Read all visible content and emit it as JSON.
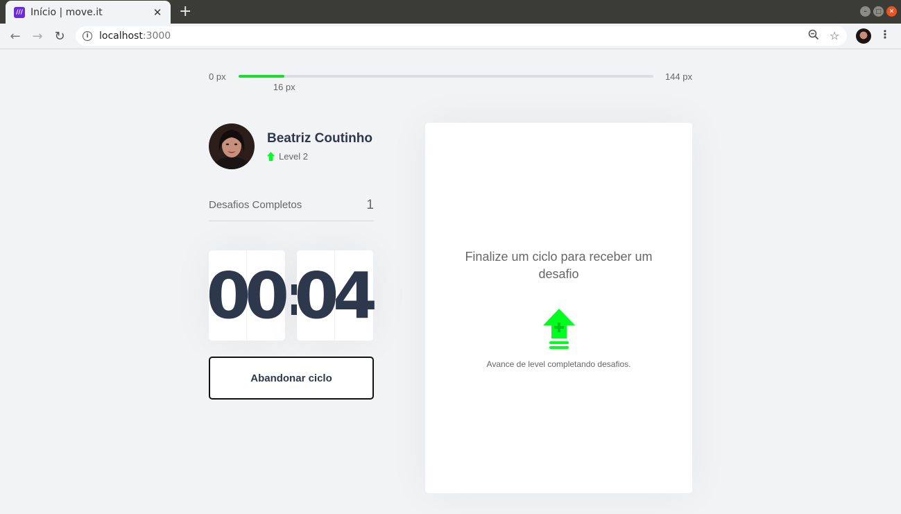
{
  "browser": {
    "tab_title": "Início | move.it",
    "favicon_text": "///",
    "url_host": "localhost",
    "url_port": ":3000"
  },
  "experience": {
    "min_label": "0 px",
    "max_label": "144 px",
    "current_label": "16 px",
    "current_fraction": 0.11,
    "fill_color": "#1ddc30"
  },
  "profile": {
    "name": "Beatriz Coutinho",
    "level_label": "Level 2"
  },
  "completed_challenges": {
    "label": "Desafios Completos",
    "value": "1"
  },
  "countdown": {
    "minute_left": "0",
    "minute_right": "0",
    "separator": ":",
    "second_left": "0",
    "second_right": "4"
  },
  "actions": {
    "abandon_label": "Abandonar ciclo"
  },
  "challenge": {
    "title": "Finalize um ciclo para receber um desafio",
    "hint": "Avance de level completando desafios.",
    "accent_color": "#00ff1e"
  }
}
